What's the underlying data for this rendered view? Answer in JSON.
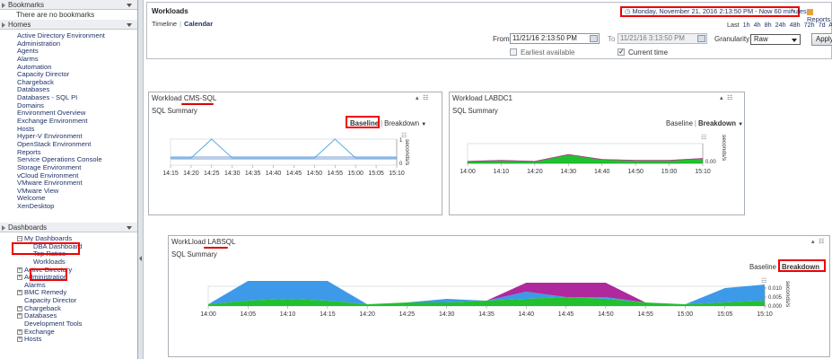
{
  "sidebar": {
    "bookmarks": {
      "header": "Bookmarks",
      "empty_text": "There are no bookmarks"
    },
    "homes": {
      "header": "Homes",
      "items": [
        "Active Directory Environment",
        "Administration",
        "Agents",
        "Alarms",
        "Automation",
        "Capacity Director",
        "Chargeback",
        "Databases",
        "Databases - SQL PI",
        "Domains",
        "Environment Overview",
        "Exchange Environment",
        "Hosts",
        "Hyper-V Environment",
        "OpenStack Environment",
        "Reports",
        "Service Operations Console",
        "Storage Environment",
        "vCloud Environment",
        "VMware Environment",
        "VMware View",
        "Welcome",
        "XenDesktop"
      ]
    },
    "dashboards": {
      "header": "Dashboards",
      "my_dashboards": "My Dashboards",
      "my_children": [
        "DBA Dashboard",
        "Top Ratios",
        "Workloads"
      ],
      "items": [
        "Active Directory",
        "Administration",
        "Alarms",
        "BMC Remedy",
        "Capacity Director",
        "Chargeback",
        "Databases",
        "Development Tools",
        "Exchange",
        "Hosts"
      ],
      "expandable": [
        true,
        true,
        false,
        true,
        false,
        true,
        true,
        false,
        true,
        true
      ]
    }
  },
  "topbar": {
    "title": "Workloads",
    "tabs": [
      "Timeline",
      "Calendar"
    ],
    "active_tab": "Calendar",
    "time_range": "Monday, November 21, 2016 2:13:50 PM - Now 60 minutes",
    "reports_label": "Reports",
    "quick_ranges": [
      "Last",
      "1h",
      "4h",
      "8h",
      "24h",
      "48h",
      "72h",
      "7d",
      "All",
      "M"
    ],
    "from_label": "From",
    "from_value": "11/21/16 2:13:50 PM",
    "to_label": "To",
    "to_value": "11/21/16 3:13:50 PM",
    "granularity_label": "Granularity",
    "granularity_value": "Raw",
    "apply_label": "Apply",
    "earliest_label": "Earliest available",
    "current_label": "Current time"
  },
  "panels": {
    "cms": {
      "title": "Workload CMS-SQL",
      "subtitle": "SQL Summary",
      "baseline": "Baseline",
      "breakdown": "Breakdown",
      "y_unit": "seconds/s"
    },
    "labdc1": {
      "title": "Workload LABDC1",
      "subtitle": "SQL Summary",
      "baseline": "Baseline",
      "breakdown": "Breakdown",
      "y_unit": "seconds/s"
    },
    "labsql": {
      "title": "WorkLload LABSQL",
      "subtitle": "SQL Summary",
      "baseline": "Baseline",
      "breakdown": "Breakdown",
      "y_unit": "seconds/s"
    }
  },
  "chart_data": [
    {
      "type": "line",
      "panel": "cms",
      "x": [
        "14:15",
        "14:20",
        "14:25",
        "14:30",
        "14:35",
        "14:40",
        "14:45",
        "14:50",
        "14:55",
        "15:00",
        "15:05",
        "15:10"
      ],
      "series": [
        {
          "values": [
            0,
            0,
            1,
            0,
            0,
            0,
            0,
            0,
            1,
            0,
            0,
            0
          ]
        }
      ],
      "y_ticks": [
        "1",
        "0"
      ],
      "ylabel": "seconds/s",
      "baseline_band": true,
      "colors": {
        "line": "#4aa8e6",
        "band": "#b9cde9"
      }
    },
    {
      "type": "area",
      "panel": "labdc1",
      "x": [
        "14:00",
        "14:10",
        "14:20",
        "14:30",
        "14:40",
        "14:50",
        "15:00",
        "15:10"
      ],
      "series": [
        {
          "values": [
            0.002,
            0.003,
            0.002,
            0.009,
            0.004,
            0.003,
            0.003,
            0.005
          ]
        }
      ],
      "y_ticks": [
        "0.00"
      ],
      "ylabel": "seconds/s",
      "colors": {
        "fill": "#21c12e",
        "top": "#bf2f9a"
      }
    },
    {
      "type": "area",
      "panel": "labsql",
      "x": [
        "14:00",
        "14:05",
        "14:10",
        "14:15",
        "14:20",
        "14:25",
        "14:30",
        "14:35",
        "14:40",
        "14:45",
        "14:50",
        "14:55",
        "15:00",
        "15:05",
        "15:10"
      ],
      "series": [
        {
          "values": [
            0.001,
            0.003,
            0.004,
            0.003,
            0.001,
            0.002,
            0.002,
            0.003,
            0.004,
            0.005,
            0.004,
            0.002,
            0.001,
            0.002,
            0.003
          ]
        },
        {
          "values": [
            0.0,
            0.011,
            0.01,
            0.011,
            0.0,
            0.0,
            0.002,
            0.0,
            0.004,
            0.0,
            0.001,
            0.0,
            0.0,
            0.008,
            0.009
          ]
        },
        {
          "values": [
            0.0,
            0.0,
            0.0,
            0.0,
            0.0,
            0.0,
            0.0,
            0.0,
            0.005,
            0.008,
            0.008,
            0.0,
            0.0,
            0.0,
            0.0
          ]
        }
      ],
      "y_ticks": [
        "0.010",
        "0.005",
        "0.000"
      ],
      "ylabel": "seconds/s",
      "colors": [
        "#21c12e",
        "#3d9ae8",
        "#b0289e"
      ]
    }
  ]
}
